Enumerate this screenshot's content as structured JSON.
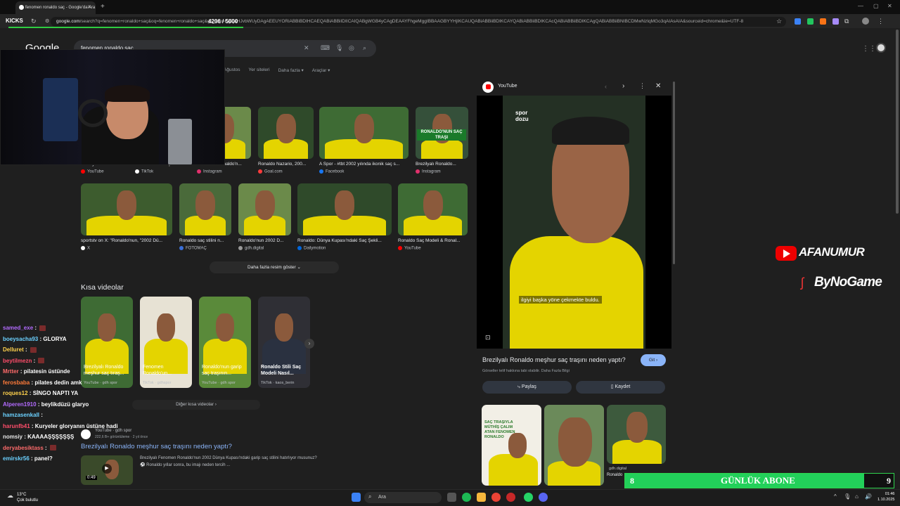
{
  "browser": {
    "tab_title": "fenomen ronaldo saç - Google'da Ara",
    "url_host": "google.com",
    "url_path": "/search?q=fenomen+ronaldo+saç&oq=fenomen+ronaldo+saç&gs_lcrp=EgZjaHJvbWUyDAgAEEUYORiABBiBDIHCAEQABiABBiIDIICAIQABgWGB4yCAgDEAAYFhgeMggIBBAAGBYYHjIKCAUQABiABBiiBDIKCAYQABiABBiiBDIKCAcQABiABBiiBDIKCAgQABiABBiiBNIBCDMwNzIqMGo3qAIAsAIA&sourceid=chrome&ie=UTF-8"
  },
  "stream": {
    "kicks_label": "KICKS",
    "kicks_progress_text": "4206 / 5000",
    "kicks_progress_fraction": 0.84,
    "brand_youtube": "AFANUMUR",
    "brand_sponsor": "ByNoGame",
    "sub_goal_current": "8",
    "sub_goal_label": "GÜNLÜK ABONE",
    "sub_goal_target": "9"
  },
  "google": {
    "logo": "Google",
    "query": "fenomen ronaldo saç",
    "filters": [
      "Ağustos",
      "Yer siteleri",
      "Daha fazla ▾",
      "Araçlar ▾"
    ],
    "image_row1": [
      {
        "caption": "Brezilyalı Ronaldo m...",
        "source": "YouTube",
        "src_color": "#ff0000"
      },
      {
        "caption": "Ronaldo'nun meşhur...",
        "source": "TikTok",
        "src_color": "#ffffff"
      },
      {
        "caption": "Fenomen Ronaldo'n...",
        "source": "Instagram",
        "src_color": "#e1306c"
      },
      {
        "caption": "Ronaldo Nazario, 200...",
        "source": "Goal.com",
        "src_color": "#ff3b3b"
      },
      {
        "caption": "A Spor - #tbt 2002 yılında ikonik saç s...",
        "source": "Facebook",
        "src_color": "#1877f2"
      },
      {
        "caption": "Brezilyalı Ronaldo...",
        "source": "Instagram",
        "src_color": "#e1306c"
      }
    ],
    "image_row2": [
      {
        "caption": "sportstv on X: \"Ronaldo'nun, \"2002 Dü...",
        "source": "X",
        "src_color": "#ffffff"
      },
      {
        "caption": "Ronaldo saç stilini n...",
        "source": "FOTOMAÇ",
        "src_color": "#3a6fd8"
      },
      {
        "caption": "Ronaldo'nun 2002 D...",
        "source": "gdh.digital",
        "src_color": "#999999"
      },
      {
        "caption": "Ronaldo: Dünya Kupası'ndaki Saç Şekli...",
        "source": "Dailymotion",
        "src_color": "#0066dc"
      },
      {
        "caption": "Ronaldo Saç Modeli & Ronal...",
        "source": "YouTube",
        "src_color": "#ff0000"
      }
    ],
    "thumb_overlay": "RONALDO'NUN SAÇ TRAŞI",
    "more_images": "Daha fazla resim göster ⌄",
    "shorts_title": "Kısa videolar",
    "shorts": [
      {
        "caption": "Brezilyalı Ronaldo meşhur saç tıraş...",
        "source": "YouTube · gdh spor"
      },
      {
        "caption": "Fenomen Ronaldo'un...",
        "source": "TikTok · gdhspor"
      },
      {
        "caption": "Ronaldo'nun garip saç traşının...",
        "source": "YouTube · gdh spor"
      },
      {
        "caption": "Ronaldo Stili Saç Modeli Nasıl...",
        "source": "TikTok · kaos_berin"
      }
    ],
    "more_shorts": "Diğer kısa videolar ›",
    "result_channel": "YouTube · gdh spor",
    "result_meta": "222,6 B+ görüntüleme · 2 yıl önce",
    "result_title": "Brezilyalı Ronaldo meşhur saç traşını neden yaptı?",
    "result_desc": "Brezilyalı Fenomen Ronaldo'nun 2002 Dünya Kupası'ndaki garip saç stilini hatırlıyor musunuz? ⚽ Ronaldo yıllar sonra, bu imajı neden tercih ...",
    "result_duration": "0:49"
  },
  "side_panel": {
    "source": "YouTube",
    "subtitle": "ilgiyi başka yöne çekmekte buldu.",
    "watermark": "spor dozu",
    "title": "Brezilyalı Ronaldo meşhur saç traşını neden yaptı?",
    "go_button": "Git ›",
    "note": "Görseller telif hakkına tabi olabilir. Daha Fazla Bilgi",
    "share_button": "Paylaş",
    "save_button": "Kaydet",
    "related_overlay": "SAÇ TRAŞIYLA MÜTHİŞ ÇALIM ATAN FENOMEN RONALDO",
    "related_caption": "gdh.digital",
    "related_sub": "Ronaldo"
  },
  "chat": [
    {
      "user": "samed_exe",
      "text": "",
      "color": "#b36bff",
      "badge": true
    },
    {
      "user": "boeysacha93",
      "text": "GLORYA",
      "color": "#6bd1ff",
      "badge": false
    },
    {
      "user": "Delluret",
      "text": "",
      "color": "#ffd24d",
      "badge": true
    },
    {
      "user": "beytilmezn",
      "text": "",
      "color": "#ff4d6a",
      "badge": true
    },
    {
      "user": "Mrtter",
      "text": "pilatesin üstünde",
      "color": "#ff6b6b",
      "badge": false
    },
    {
      "user": "ferosbaba",
      "text": "pilates dedin amk",
      "color": "#ff7b3a",
      "badge": false
    },
    {
      "user": "roques12",
      "text": "SİNGO NAPTI YA",
      "color": "#ffd24d",
      "badge": false
    },
    {
      "user": "Alperen1910",
      "text": "beylikdüzü glaryo",
      "color": "#b36bff",
      "badge": false
    },
    {
      "user": "hamzasenkall",
      "text": "",
      "color": "#6bd1ff",
      "badge": false
    },
    {
      "user": "harunfb41",
      "text": "Kuryeler gloryanın üstüne hadi",
      "color": "#ff4d6a",
      "badge": false
    },
    {
      "user": "nomsiy",
      "text": "KAAAAŞŞŞŞŞŞŞ",
      "color": "#e6e6e6",
      "badge": false
    },
    {
      "user": "deryabesiktass",
      "text": "",
      "color": "#ff6b6b",
      "badge": true
    },
    {
      "user": "emirskr56",
      "text": "panel?",
      "color": "#6bd1ff",
      "badge": false
    }
  ],
  "taskbar": {
    "temperature": "13°C",
    "weather": "Çok bulutlu",
    "search_label": "Ara",
    "time": "01:46",
    "date": "1.10.2025"
  }
}
